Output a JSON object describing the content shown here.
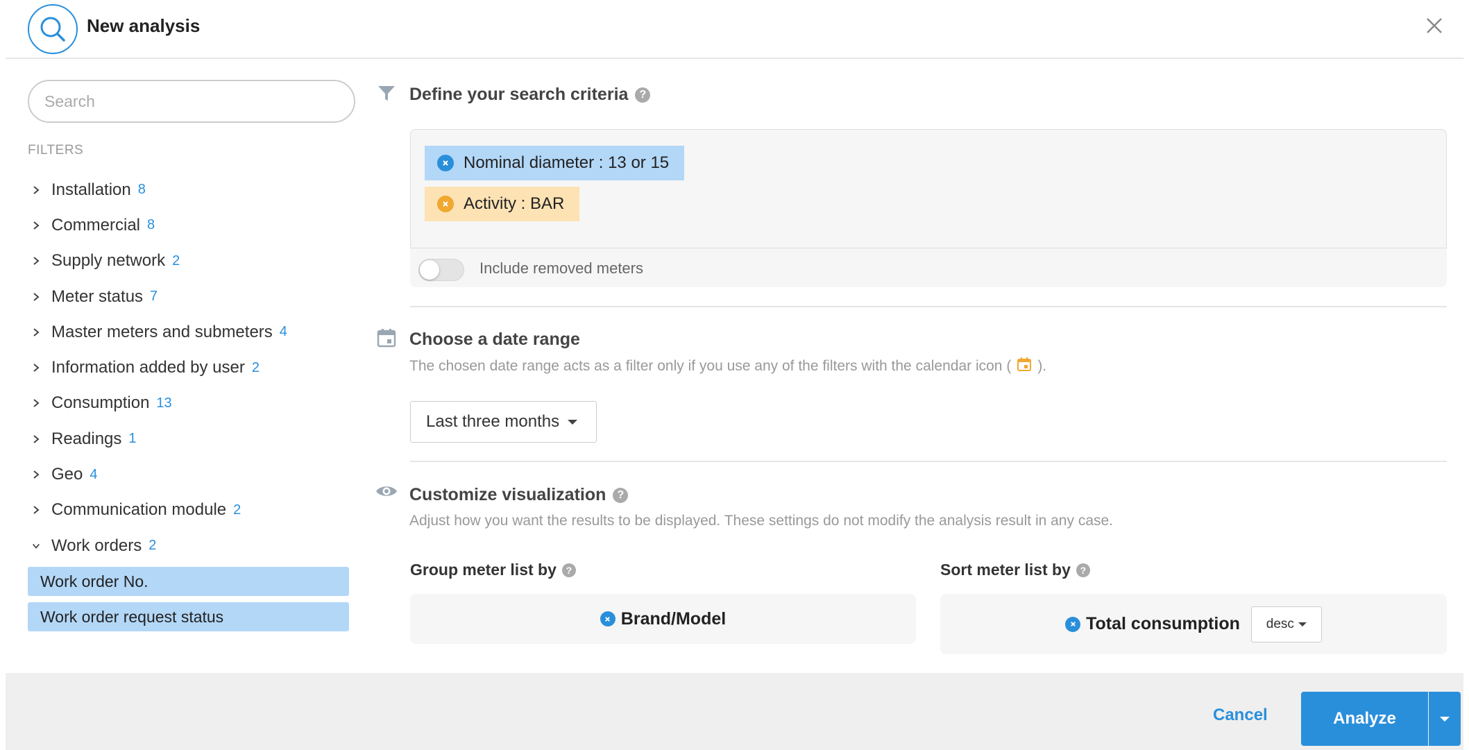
{
  "header": {
    "title": "New analysis",
    "logo_icon": "search-icon",
    "close_icon": "close-icon"
  },
  "sidebar": {
    "search_placeholder": "Search",
    "filters_title": "FILTERS",
    "items": [
      {
        "label": "Installation",
        "count": "8",
        "expanded": false
      },
      {
        "label": "Commercial",
        "count": "8",
        "expanded": false
      },
      {
        "label": "Supply network",
        "count": "2",
        "expanded": false
      },
      {
        "label": "Meter status",
        "count": "7",
        "expanded": false
      },
      {
        "label": "Master meters and submeters",
        "count": "4",
        "expanded": false
      },
      {
        "label": "Information added by user",
        "count": "2",
        "expanded": false
      },
      {
        "label": "Consumption",
        "count": "13",
        "expanded": false
      },
      {
        "label": "Readings",
        "count": "1",
        "expanded": false
      },
      {
        "label": "Geo",
        "count": "4",
        "expanded": false
      },
      {
        "label": "Communication module",
        "count": "2",
        "expanded": false
      },
      {
        "label": "Work orders",
        "count": "2",
        "expanded": true
      }
    ],
    "sub_items": [
      {
        "label": "Work order No."
      },
      {
        "label": "Work order request status"
      }
    ]
  },
  "criteria": {
    "title": "Define your search criteria",
    "help": "?",
    "chips": [
      {
        "label": "Nominal diameter : 13 or 15",
        "color": "#b3d7f7"
      },
      {
        "label": "Activity : BAR",
        "color": "#fde2b4"
      }
    ],
    "toggle_label": "Include removed meters",
    "toggle_on": false
  },
  "date_range": {
    "title": "Choose a date range",
    "description_before": "The chosen date range acts as a filter only if you use any of the filters with the calendar icon (",
    "description_after": ").",
    "selected": "Last three months"
  },
  "visualization": {
    "title": "Customize visualization",
    "help": "?",
    "description": "Adjust how you want the results to be displayed. These settings do not modify the analysis result in any case.",
    "group_label": "Group meter list by",
    "group_value": "Brand/Model",
    "sort_label": "Sort meter list by",
    "sort_value": "Total consumption",
    "sort_order": "desc"
  },
  "footer": {
    "cancel_label": "Cancel",
    "analyze_label": "Analyze"
  },
  "colors": {
    "accent": "#2a8fdb",
    "chip_blue": "#b3d7f7",
    "chip_orange": "#fde2b4",
    "calendar_icon": "#f0a830"
  }
}
